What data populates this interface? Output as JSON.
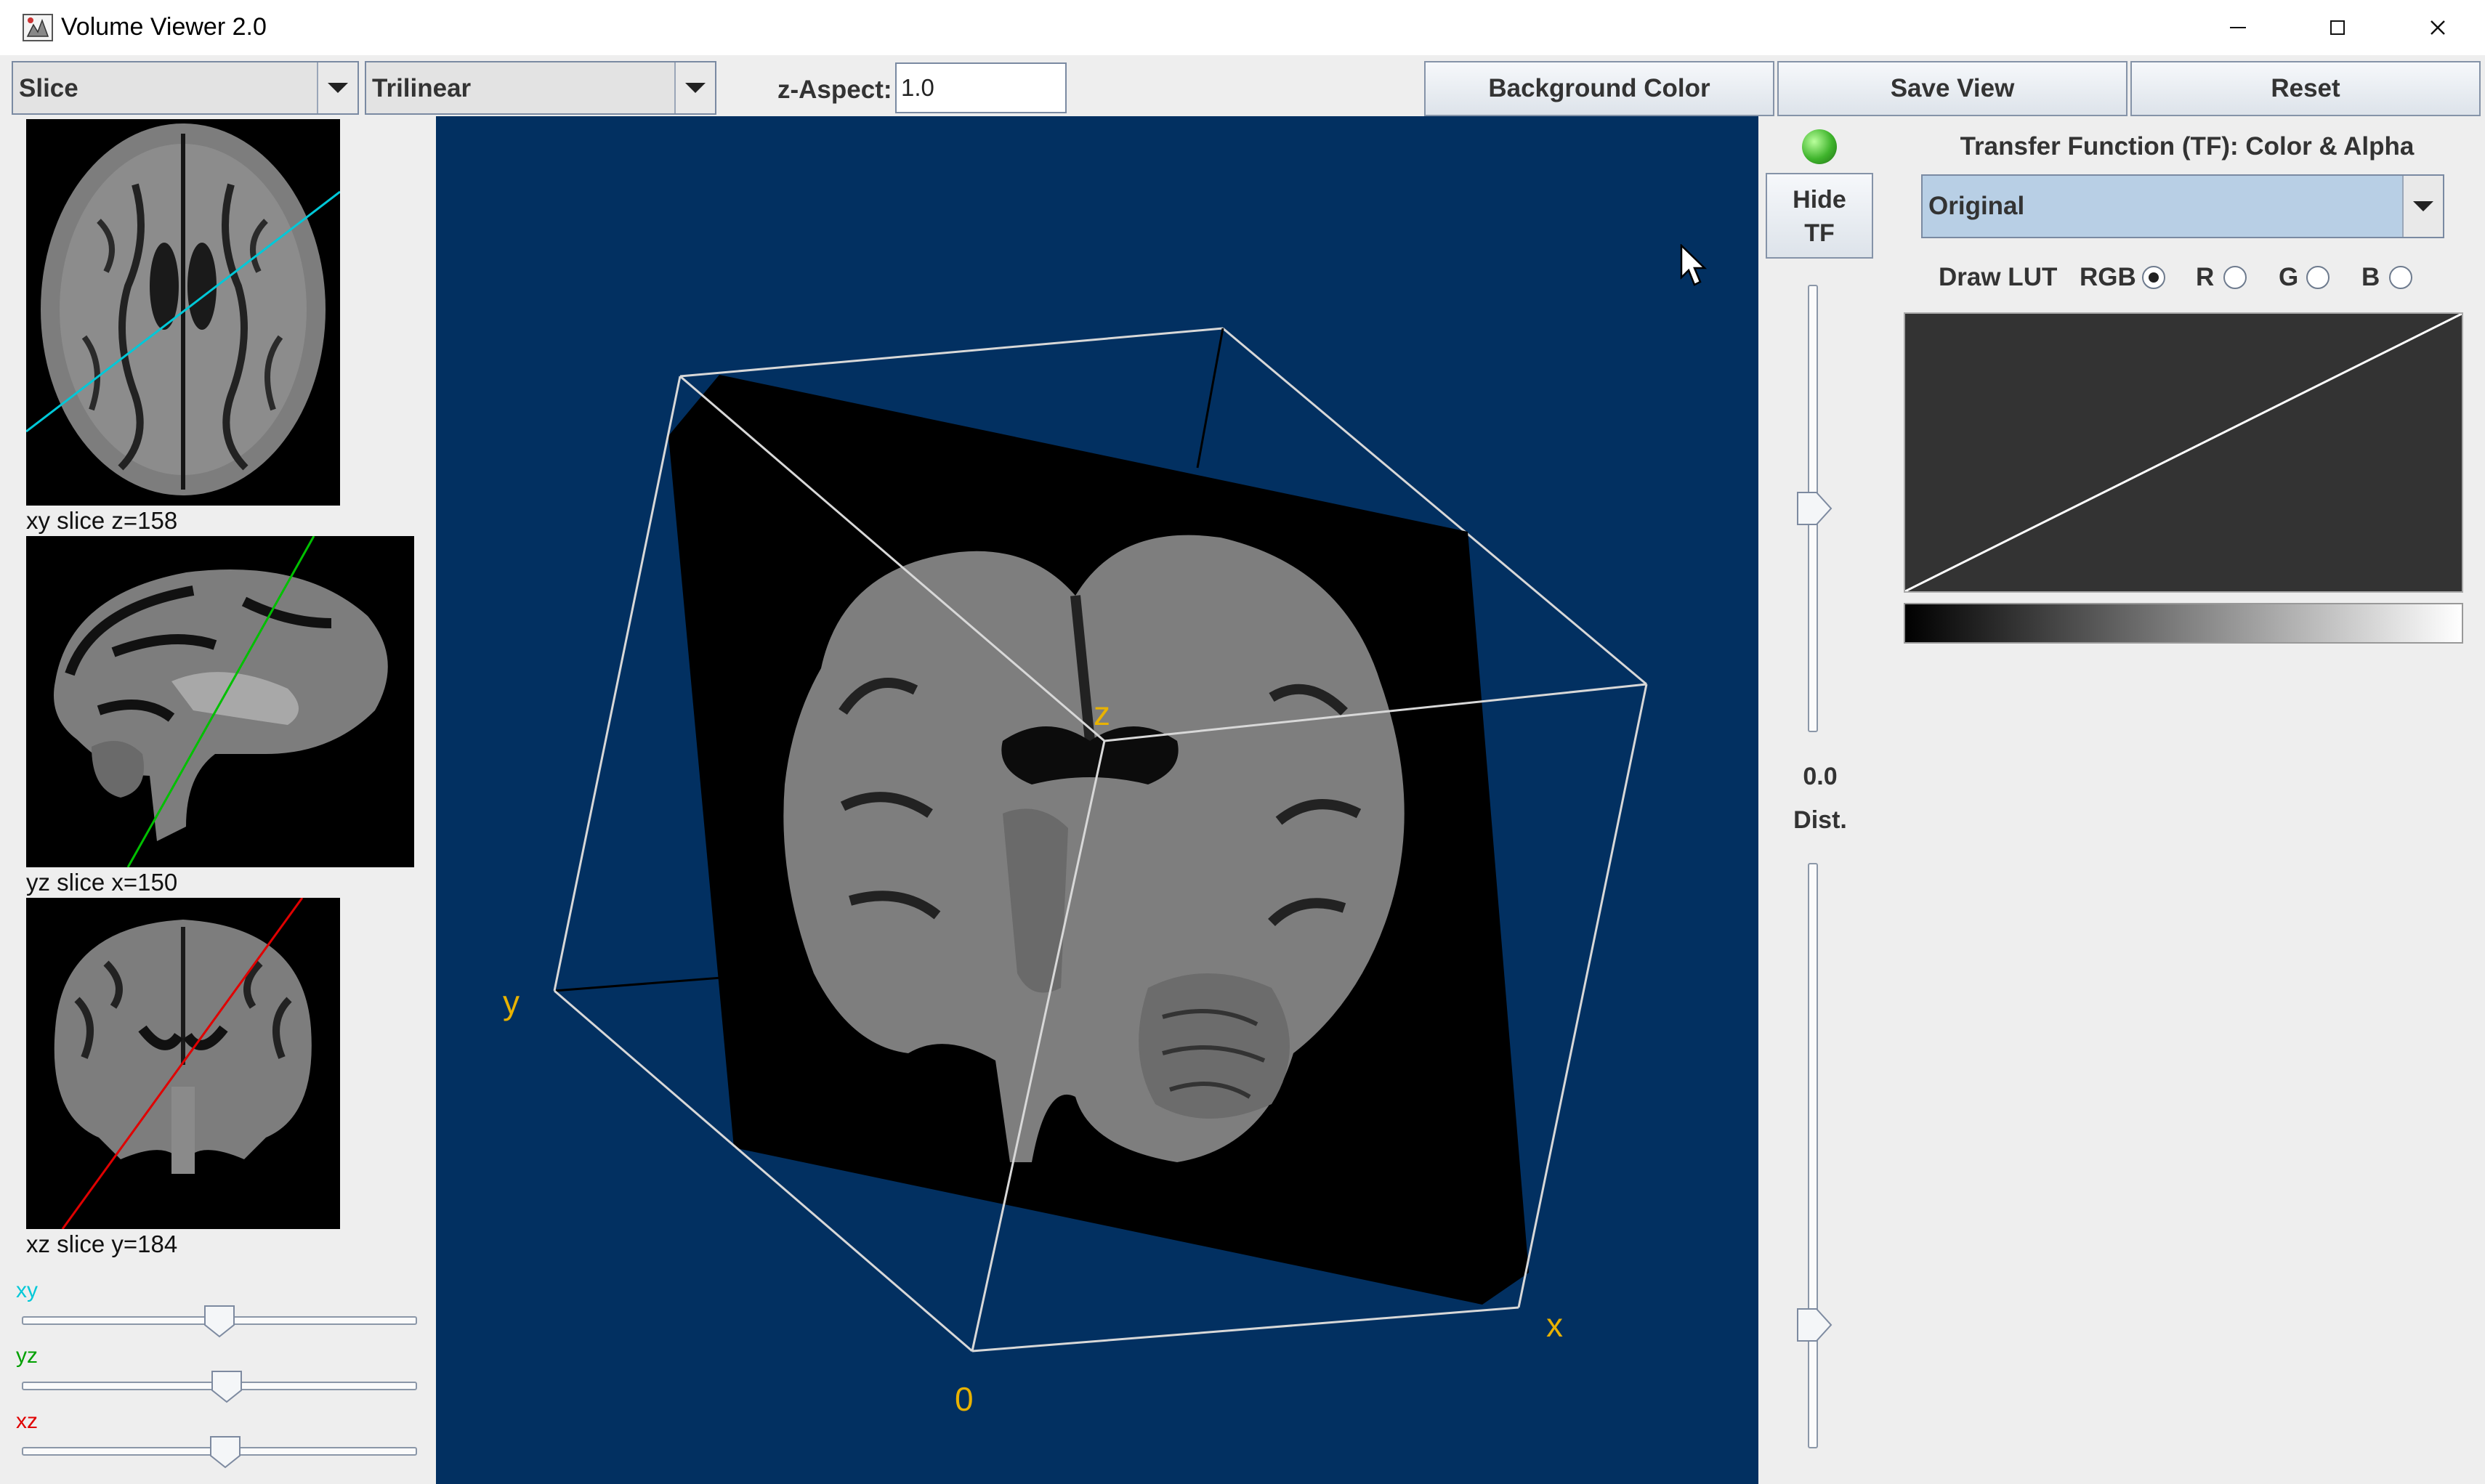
{
  "window": {
    "title": "Volume Viewer 2.0"
  },
  "toolbar": {
    "mode_select": "Slice",
    "interp_select": "Trilinear",
    "zaspect_label": "z-Aspect:",
    "zaspect_value": "1.0",
    "background_color_label": "Background Color",
    "save_view_label": "Save View",
    "reset_label": "Reset"
  },
  "slices": {
    "xy": {
      "caption": "xy slice  z=158",
      "slider_label": "xy",
      "slider_value_fraction": 0.5,
      "color": "#00c8d8"
    },
    "yz": {
      "caption": "yz slice  x=150",
      "slider_label": "yz",
      "slider_value_fraction": 0.5,
      "color": "#00c000"
    },
    "xz": {
      "caption": "xz slice  y=184",
      "slider_label": "xz",
      "slider_value_fraction": 0.5,
      "color": "#e00000"
    }
  },
  "viewer": {
    "background": "#023061",
    "axis_labels": {
      "x": "x",
      "y": "y",
      "z": "z",
      "origin": "0"
    },
    "axis_label_color": "#e8b200"
  },
  "side": {
    "hide_tf_label": "Hide TF",
    "dist_value": "0.0",
    "dist_label": "Dist."
  },
  "tf": {
    "title": "Transfer Function (TF): Color & Alpha",
    "lut_select": "Original",
    "draw_lut_label": "Draw LUT",
    "channels": [
      {
        "label": "RGB",
        "selected": true
      },
      {
        "label": "R",
        "selected": false
      },
      {
        "label": "G",
        "selected": false
      },
      {
        "label": "B",
        "selected": false
      }
    ]
  }
}
